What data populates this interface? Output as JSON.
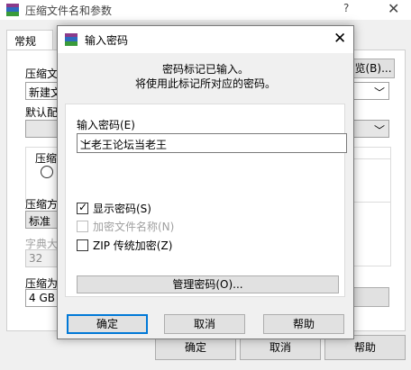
{
  "background": {
    "title": "压缩文件名和参数",
    "help": "?",
    "close": "✕",
    "tab_general": "常规",
    "browse_btn": "浏览(B)...",
    "label_archive_name": "压缩文",
    "archive_name_value": "新建文",
    "label_default_profile": "默认配",
    "label_compress_format": "压缩文",
    "format_radio": "R",
    "label_method": "压缩方",
    "method_value": "标准",
    "label_dict": "字典大",
    "dict_value": "32",
    "label_split": "压缩为",
    "split_value": "4 GB",
    "ok": "确定",
    "cancel": "取消",
    "help_btn": "帮助"
  },
  "dialog": {
    "title": "输入密码",
    "close": "✕",
    "info_line1": "密码标记已输入。",
    "info_line2": "将使用此标记所对应的密码。",
    "password_label": "输入密码(E)",
    "password_value": "上老王论坛当老王",
    "dropdown_arrow": "﹀",
    "show_password": "显示密码(S)",
    "encrypt_names": "加密文件名称(N)",
    "zip_legacy": "ZIP 传统加密(Z)",
    "manage_passwords": "管理密码(O)...",
    "ok": "确定",
    "cancel": "取消",
    "help": "帮助",
    "show_password_checked": true,
    "encrypt_names_checked": false,
    "zip_legacy_checked": false
  }
}
